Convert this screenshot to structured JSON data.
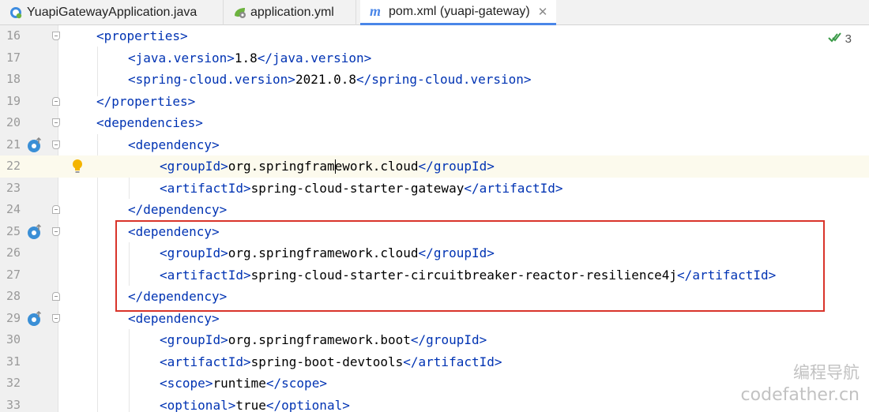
{
  "tabs": [
    {
      "label": "YuapiGatewayApplication.java",
      "icon": "spring-boot-class-icon",
      "active": false
    },
    {
      "label": "application.yml",
      "icon": "spring-config-icon",
      "active": false
    },
    {
      "label": "pom.xml (yuapi-gateway)",
      "icon": "maven-icon",
      "icon_glyph": "m",
      "active": true,
      "close": "✕"
    }
  ],
  "inspection": {
    "count": "3",
    "icon": "double-check-icon"
  },
  "editor": {
    "current_line": "22",
    "lines": [
      {
        "num": "16",
        "open": "<",
        "tag": "properties",
        "close": ">",
        "text": "",
        "end": ""
      },
      {
        "num": "17",
        "open": "<",
        "tag": "java.version",
        "close": ">",
        "text": "1.8",
        "end": "</java.version>"
      },
      {
        "num": "18",
        "open": "<",
        "tag": "spring-cloud.version",
        "close": ">",
        "text": "2021.0.8",
        "end": "</spring-cloud.version>"
      },
      {
        "num": "19",
        "open": "</",
        "tag": "properties",
        "close": ">",
        "text": "",
        "end": ""
      },
      {
        "num": "20",
        "open": "<",
        "tag": "dependencies",
        "close": ">",
        "text": "",
        "end": ""
      },
      {
        "num": "21",
        "open": "<",
        "tag": "dependency",
        "close": ">",
        "text": "",
        "end": ""
      },
      {
        "num": "22",
        "open": "<",
        "tag": "groupId",
        "close": ">",
        "text_a": "org.springfram",
        "text_b": "ework.cloud",
        "end": "</groupId>"
      },
      {
        "num": "23",
        "open": "<",
        "tag": "artifactId",
        "close": ">",
        "text": "spring-cloud-starter-gateway",
        "end": "</artifactId>"
      },
      {
        "num": "24",
        "open": "</",
        "tag": "dependency",
        "close": ">",
        "text": "",
        "end": ""
      },
      {
        "num": "25",
        "open": "<",
        "tag": "dependency",
        "close": ">",
        "text": "",
        "end": ""
      },
      {
        "num": "26",
        "open": "<",
        "tag": "groupId",
        "close": ">",
        "text": "org.springframework.cloud",
        "end": "</groupId>"
      },
      {
        "num": "27",
        "open": "<",
        "tag": "artifactId",
        "close": ">",
        "text": "spring-cloud-starter-circuitbreaker-reactor-resilience4j",
        "end": "</artifactId>"
      },
      {
        "num": "28",
        "open": "</",
        "tag": "dependency",
        "close": ">",
        "text": "",
        "end": ""
      },
      {
        "num": "29",
        "open": "<",
        "tag": "dependency",
        "close": ">",
        "text": "",
        "end": ""
      },
      {
        "num": "30",
        "open": "<",
        "tag": "groupId",
        "close": ">",
        "text": "org.springframework.boot",
        "end": "</groupId>"
      },
      {
        "num": "31",
        "open": "<",
        "tag": "artifactId",
        "close": ">",
        "text": "spring-boot-devtools",
        "end": "</artifactId>"
      },
      {
        "num": "32",
        "open": "<",
        "tag": "scope",
        "close": ">",
        "text": "runtime",
        "end": "</scope>"
      },
      {
        "num": "33",
        "open": "<",
        "tag": "optional",
        "close": ">",
        "text": "true",
        "end": "</optional>"
      }
    ]
  },
  "watermark": {
    "line1": "编程导航",
    "line2": "codefather.cn"
  },
  "colors": {
    "tag": "#0033b3",
    "highlight_border": "#d9342b",
    "active_tab_underline": "#4a86e8",
    "current_line_bg": "#fcfaed"
  }
}
